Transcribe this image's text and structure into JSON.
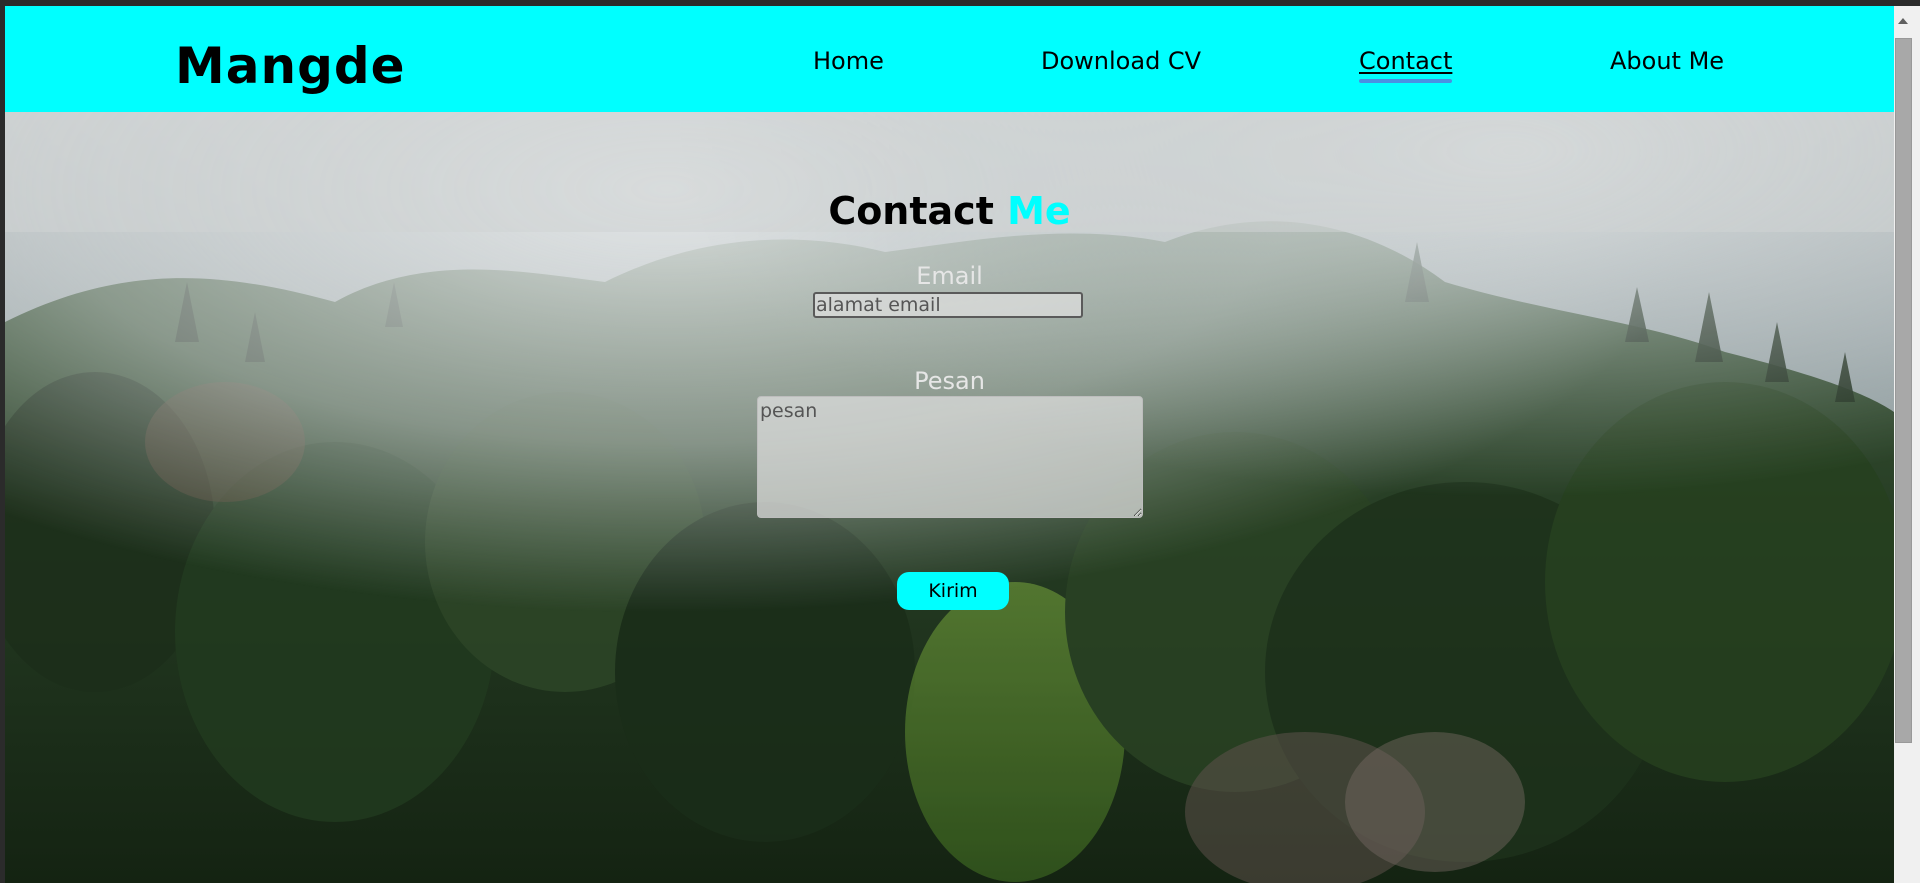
{
  "navbar": {
    "brand": "Mangde",
    "links": [
      {
        "label": "Home",
        "active": false
      },
      {
        "label": "Download CV",
        "active": false
      },
      {
        "label": "Contact",
        "active": true
      },
      {
        "label": "About Me",
        "active": false
      }
    ]
  },
  "contact": {
    "title_main": "Contact",
    "title_accent": "Me",
    "email_label": "Email",
    "email_placeholder": "alamat email",
    "email_value": "",
    "message_label": "Pesan",
    "message_placeholder": "pesan",
    "message_value": "",
    "submit_label": "Kirim"
  },
  "colors": {
    "accent": "#00ffff",
    "nav_underline": "#4a90e2",
    "brand_text": "#000000",
    "label_text": "#e6e6e6"
  },
  "icons": {
    "scroll_up": "chevron-up-icon"
  }
}
